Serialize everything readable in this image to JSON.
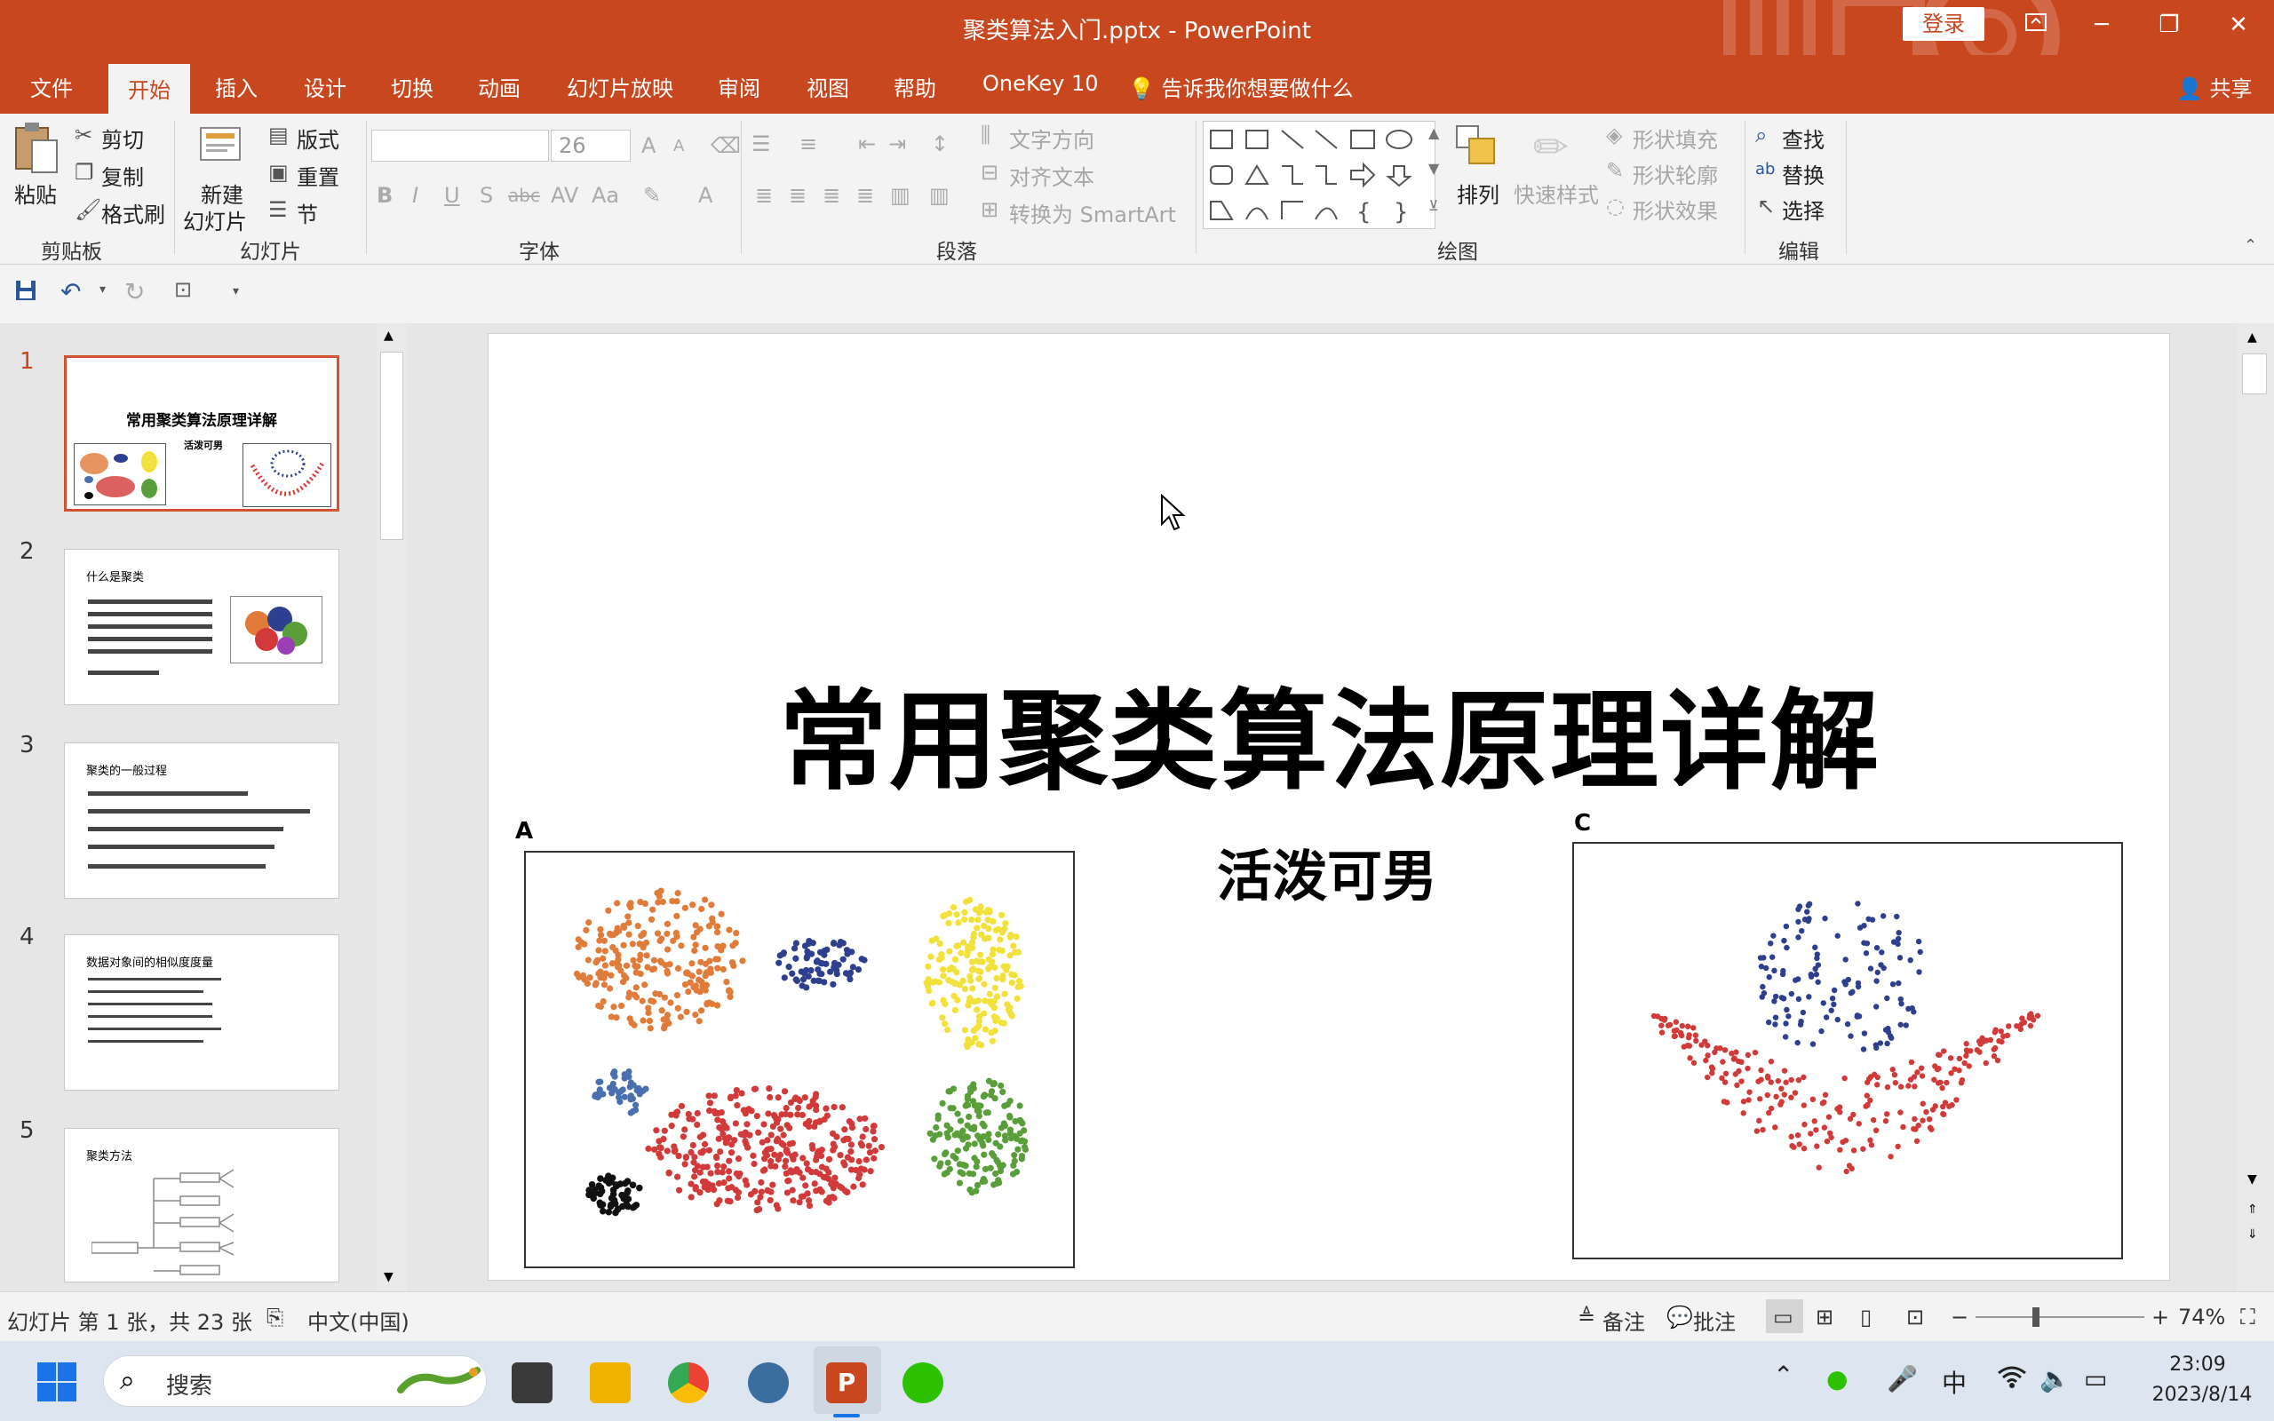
{
  "window": {
    "title": "聚类算法入门.pptx  -  PowerPoint",
    "login": "登录",
    "ribbon_display_icon": "ribbon-display-icon",
    "minimize": "─",
    "restore": "❐",
    "close": "✕"
  },
  "tabs": {
    "file": "文件",
    "home": "开始",
    "insert": "插入",
    "design": "设计",
    "transitions": "切换",
    "animations": "动画",
    "slideshow": "幻灯片放映",
    "review": "审阅",
    "view": "视图",
    "help": "帮助",
    "onekey": "OneKey 10",
    "tellme": "告诉我你想要做什么",
    "share": "共享"
  },
  "ribbon": {
    "clipboard": {
      "paste": "粘贴",
      "cut": "剪切",
      "copy": "复制",
      "format_painter": "格式刷",
      "group": "剪贴板"
    },
    "slides": {
      "new_slide_1": "新建",
      "new_slide_2": "幻灯片",
      "layout": "版式",
      "reset": "重置",
      "section": "节",
      "group": "幻灯片"
    },
    "font": {
      "font_name": "",
      "font_size": "26",
      "group": "字体"
    },
    "paragraph": {
      "text_direction": "文字方向",
      "align_text": "对齐文本",
      "convert_smartart": "转换为 SmartArt",
      "group": "段落"
    },
    "drawing": {
      "arrange": "排列",
      "quick_styles": "快速样式",
      "shape_fill": "形状填充",
      "shape_outline": "形状轮廓",
      "shape_effects": "形状效果",
      "group": "绘图"
    },
    "editing": {
      "find": "查找",
      "replace": "替换",
      "select": "选择",
      "group": "编辑"
    }
  },
  "thumbnails": [
    {
      "num": "1",
      "title": "常用聚类算法原理详解",
      "subtitle": "活泼可男"
    },
    {
      "num": "2",
      "title": "什么是聚类"
    },
    {
      "num": "3",
      "title": "聚类的一般过程"
    },
    {
      "num": "4",
      "title": "数据对象间的相似度度量"
    },
    {
      "num": "5",
      "title": "聚类方法"
    }
  ],
  "slide": {
    "title": "常用聚类算法原理详解",
    "subtitle": "活泼可男",
    "panel_a": "A",
    "panel_c": "C"
  },
  "status": {
    "slide_info": "幻灯片 第 1 张，共 23 张",
    "language": "中文(中国)",
    "notes": "备注",
    "comments": "批注",
    "zoom": "74%",
    "zoom_level": 74
  },
  "taskbar": {
    "search": "搜索",
    "time": "23:09",
    "date": "2023/8/14",
    "ime": "中"
  },
  "colors": {
    "accent": "#c9471f",
    "orange": "#e07b39",
    "blue": "#2e3f8f",
    "yellow": "#f2e13a",
    "green": "#5a9e3a",
    "red": "#d23a3a",
    "black": "#111111"
  }
}
